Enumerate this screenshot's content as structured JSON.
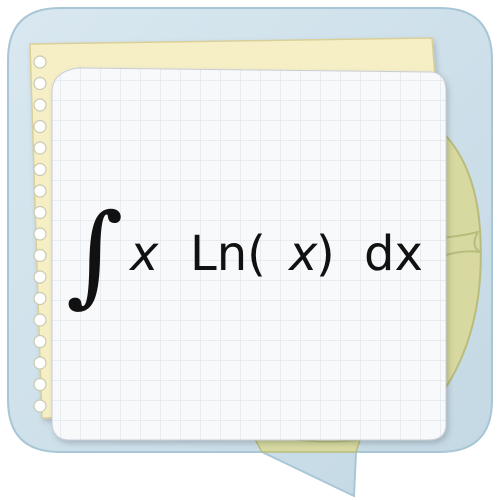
{
  "formula": {
    "integral_sign": "∫",
    "x": "x",
    "ln_open": "Ln(",
    "arg": "x",
    "ln_close": ")",
    "dx": "dx"
  },
  "colors": {
    "bubble": "#cfe0ea",
    "bubble_edge": "#a9c6d6",
    "olive_paper": "#d7d9a0",
    "olive_edge": "#b9bd7c",
    "yellow_note": "#f6efc6",
    "grid_paper": "#f8f9fb",
    "grid_line": "#d7dde6",
    "ring": "#ffffff",
    "ring_edge": "#c9c9b0"
  },
  "icons": {
    "background": "speech-bubble-icon",
    "binder_holes": "notebook-ring-holes-icon"
  }
}
